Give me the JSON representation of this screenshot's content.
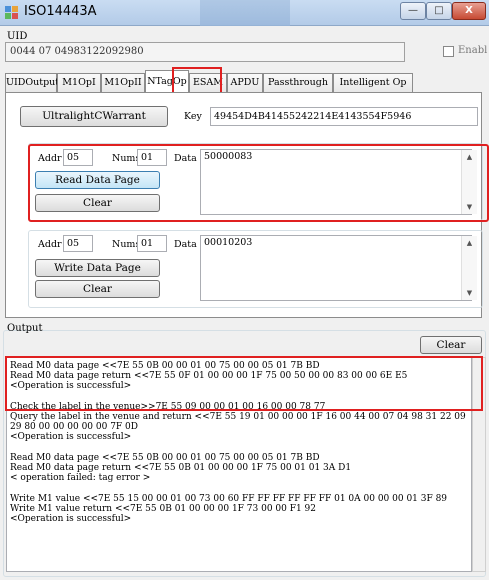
{
  "window": {
    "title": "ISO14443A",
    "min_glyph": "—",
    "max_glyph": "□",
    "close_glyph": "X"
  },
  "uid": {
    "label": "UID",
    "value": "0044 07 04983122092980",
    "enable_label": "Enabl"
  },
  "tabs": [
    {
      "label": "UIDOutput",
      "active": false
    },
    {
      "label": "M1OpI",
      "active": false
    },
    {
      "label": "M1OpII",
      "active": false
    },
    {
      "label": "NTagOp",
      "active": true
    },
    {
      "label": "ESAM",
      "active": false
    },
    {
      "label": "APDU",
      "active": false
    },
    {
      "label": "Passthrough",
      "active": false
    },
    {
      "label": "Intelligent Op",
      "active": false
    }
  ],
  "ntag": {
    "warrant_button": "UltralightCWarrant",
    "key_label": "Key",
    "key_value": "49454D4B41455242214E4143554F5946",
    "read": {
      "addr_label": "Addr",
      "addr_value": "05",
      "nums_label": "Nums",
      "nums_value": "01",
      "data_label": "Data",
      "data_value": "50000083",
      "read_button": "Read Data Page",
      "clear_button": "Clear"
    },
    "write": {
      "addr_label": "Addr",
      "addr_value": "05",
      "nums_label": "Nums",
      "nums_value": "01",
      "data_label": "Data",
      "data_value": "00010203",
      "write_button": "Write Data Page",
      "clear_button": "Clear"
    }
  },
  "output": {
    "label": "Output",
    "clear_button": "Clear",
    "log": "Read M0 data page <<7E 55 0B 00 00 01 00 75 00 00 05 01 7B BD\nRead M0 data page return <<7E 55 0F 01 00 00 00 1F 75 00 50 00 00 83 00 00 6E E5\n<Operation is successful>\n\nCheck the label in the venue>>7E 55 09 00 00 01 00 16 00 00 78 77\nQuery the label in the venue and return <<7E 55 19 01 00 00 00 1F 16 00 44 00 07 04 98 31 22 09 29 80 00 00 00 00 00 7F 0D\n<Operation is successful>\n\nRead M0 data page <<7E 55 0B 00 00 01 00 75 00 00 05 01 7B BD\nRead M0 data page return <<7E 55 0B 01 00 00 00 1F 75 00 01 01 3A D1\n< operation failed: tag error >\n\nWrite M1 value <<7E 55 15 00 00 01 00 73 00 60 FF FF FF FF FF FF 01 0A 00 00 00 01 3F 89\nWrite M1 value return <<7E 55 0B 01 00 00 00 1F 73 00 00 F1 92\n<Operation is successful>"
  }
}
